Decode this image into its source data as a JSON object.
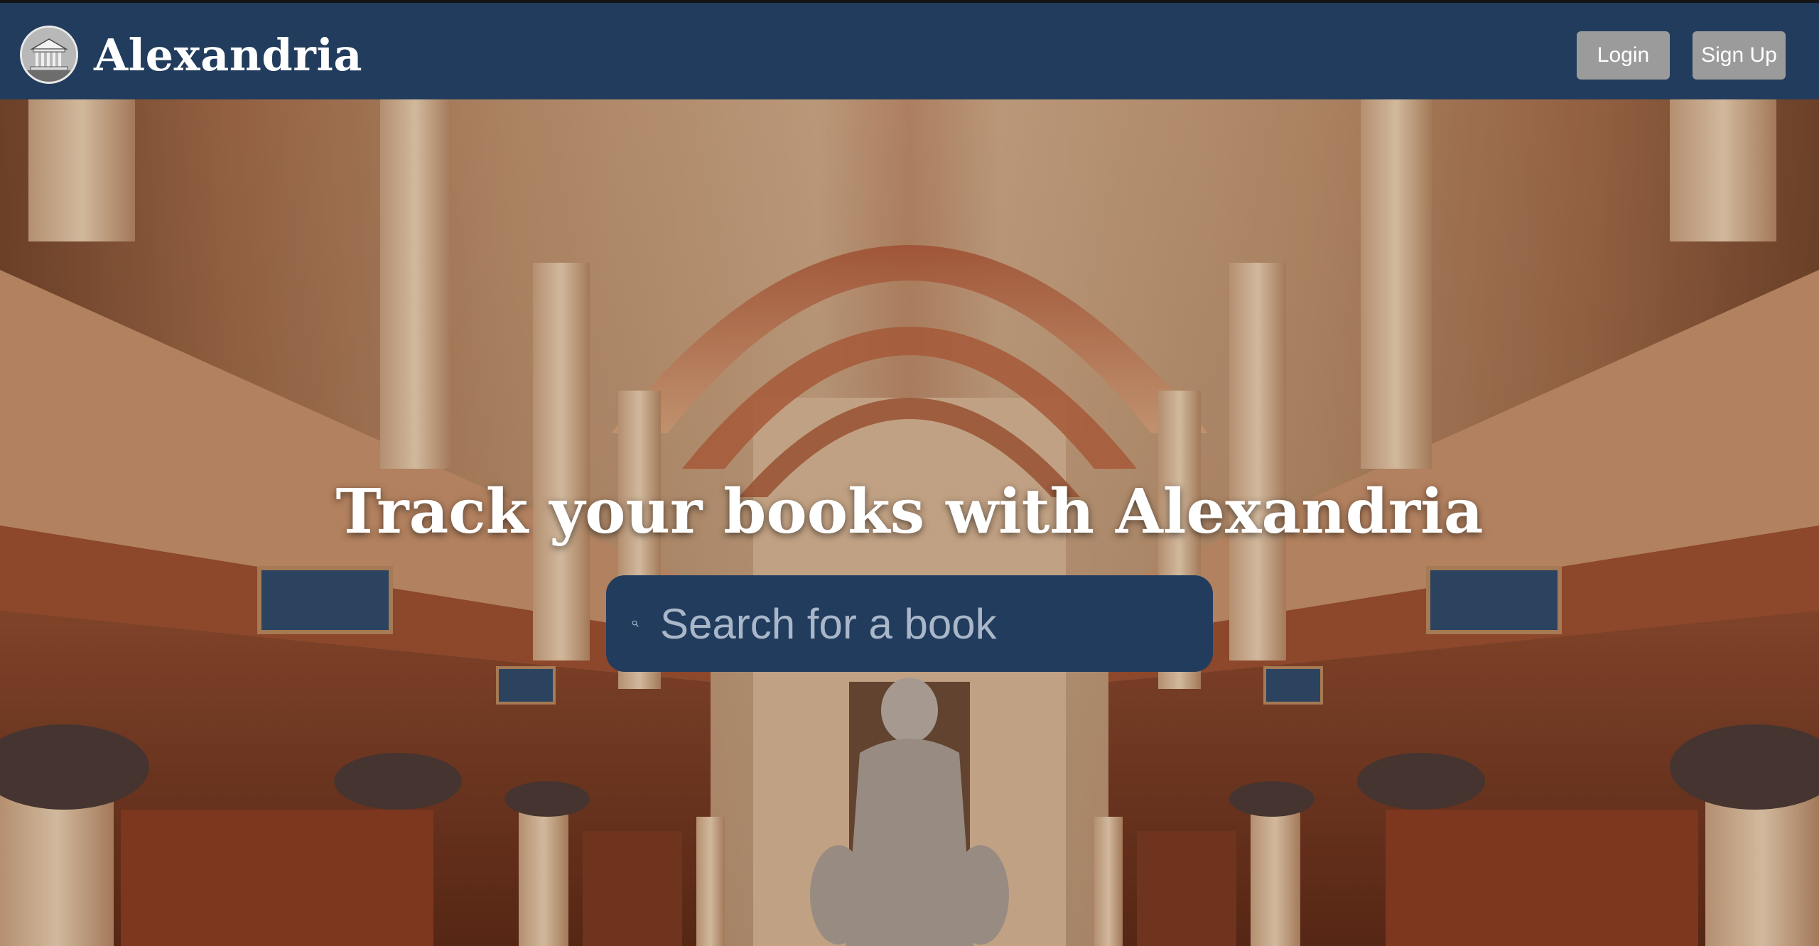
{
  "app": {
    "brand_name": "Alexandria",
    "logo_icon": "library-building-icon"
  },
  "header": {
    "login_label": "Login",
    "signup_label": "Sign Up"
  },
  "hero": {
    "title": "Track your books with Alexandria",
    "background": "library-of-alexandria-interior-image"
  },
  "search": {
    "placeholder": "Search for a book",
    "value": "",
    "icon": "search-icon"
  },
  "colors": {
    "navbar": "#223c5e",
    "search_box": "#223c5e",
    "button": "#9b9b9b",
    "text": "#ffffff"
  }
}
